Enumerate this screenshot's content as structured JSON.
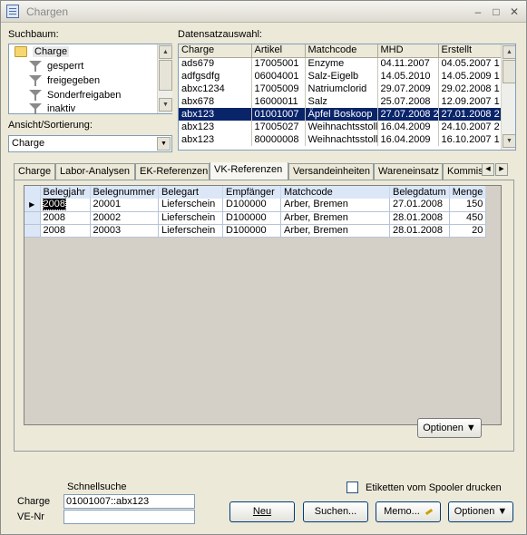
{
  "window": {
    "title": "Chargen",
    "controls": [
      "–",
      "□",
      "✕"
    ]
  },
  "suchbaum": {
    "label": "Suchbaum:",
    "items": [
      {
        "label": "Charge",
        "icon": "folder-icon"
      },
      {
        "label": "gesperrt",
        "icon": "filter-icon"
      },
      {
        "label": "freigegeben",
        "icon": "filter-icon"
      },
      {
        "label": "Sonderfreigaben",
        "icon": "filter-icon"
      },
      {
        "label": "inaktiv",
        "icon": "filter-icon"
      }
    ]
  },
  "ansicht": {
    "label": "Ansicht/Sortierung:",
    "value": "Charge"
  },
  "datensatz": {
    "label": "Datensatzauswahl:",
    "columns": [
      "Charge",
      "Artikel",
      "Matchcode",
      "MHD",
      "Erstellt"
    ],
    "rows": [
      [
        "ads679",
        "17005001",
        "Enzyme",
        "04.11.2007",
        "04.05.2007 1"
      ],
      [
        "adfgsdfg",
        "06004001",
        "Salz-Eigelb",
        "14.05.2010",
        "14.05.2009 1"
      ],
      [
        "abxc1234",
        "17005009",
        "Natriumclorid",
        "29.07.2009",
        "29.02.2008 1"
      ],
      [
        "abx678",
        "16000011",
        "Salz",
        "25.07.2008",
        "12.09.2007 1"
      ],
      [
        "abx123",
        "01001007",
        "Äpfel Boskoop",
        "27.07.2008 2",
        "27.01.2008 2"
      ],
      [
        "abx123",
        "17005027",
        "Weihnachtsstolle",
        "16.04.2009",
        "24.10.2007 2"
      ],
      [
        "abx123",
        "80000008",
        "Weihnachtsstolle",
        "16.04.2009",
        "16.10.2007 1"
      ]
    ],
    "selected_index": 4
  },
  "tabs": [
    "Charge",
    "Labor-Analysen",
    "EK-Referenzen",
    "VK-Referenzen",
    "Versandeinheiten",
    "Wareneinsatz",
    "Kommis"
  ],
  "active_tab": "VK-Referenzen",
  "vk": {
    "columns": [
      "Belegjahr",
      "Belegnummer",
      "Belegart",
      "Empfänger",
      "Matchcode",
      "Belegdatum",
      "Menge"
    ],
    "rows": [
      [
        "2008",
        "20001",
        "Lieferschein",
        "D100000",
        "Arber, Bremen",
        "27.01.2008",
        "150"
      ],
      [
        "2008",
        "20002",
        "Lieferschein",
        "D100000",
        "Arber, Bremen",
        "28.01.2008",
        "450"
      ],
      [
        "2008",
        "20003",
        "Lieferschein",
        "D100000",
        "Arber, Bremen",
        "28.01.2008",
        "20"
      ]
    ],
    "optionen_label": "Optionen"
  },
  "bottom": {
    "schnellsuche_label": "Schnellsuche",
    "charge_label": "Charge",
    "charge_value": "01001007::abx123",
    "venr_label": "VE-Nr",
    "venr_value": "",
    "etiketten_label": "Etiketten vom Spooler drucken",
    "buttons": {
      "neu": "Neu",
      "suchen": "Suchen...",
      "memo": "Memo...",
      "optionen": "Optionen"
    }
  }
}
